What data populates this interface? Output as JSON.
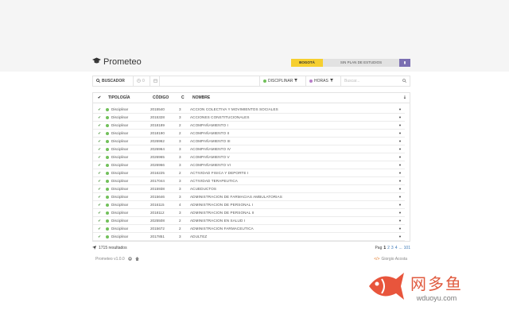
{
  "brand": {
    "name": "Prometeo",
    "icon": "graduation-cap-icon"
  },
  "tabs": [
    {
      "label": "BOGOTÁ",
      "active": true
    },
    {
      "label": "SIN PLAN DE ESTUDIOS",
      "active": false
    },
    {
      "label": "▮",
      "active": false
    }
  ],
  "toolbar": {
    "buscador_label": "BUSCADOR",
    "clock_value": "0",
    "disciplinar_label": "DISCIPLINAR",
    "horas_label": "HORAS",
    "search_placeholder": "Buscar..."
  },
  "colors": {
    "accent": "#f6cf2f",
    "disciplinar": "#71c05a",
    "horas": "#b87ec9",
    "violet": "#7b6fb2"
  },
  "table": {
    "headers": {
      "check": "✔",
      "tipologia": "TIPOLOGÍA",
      "codigo": "CÓDIGO",
      "c": "C",
      "nombre": "NOMBRE",
      "action": "⇣"
    },
    "rows": [
      {
        "tipologia": "Disciplinar",
        "codigo": "2015540",
        "c": "3",
        "nombre": "ACCION COLECTIVA Y MOVIMIENTOS SOCIALES"
      },
      {
        "tipologia": "Disciplinar",
        "codigo": "2015328",
        "c": "3",
        "nombre": "ACCIONES CONSTITUCIONALES"
      },
      {
        "tipologia": "Disciplinar",
        "codigo": "2018189",
        "c": "2",
        "nombre": "ACOMPAÑAMIENTO I"
      },
      {
        "tipologia": "Disciplinar",
        "codigo": "2018190",
        "c": "2",
        "nombre": "ACOMPAÑAMIENTO II"
      },
      {
        "tipologia": "Disciplinar",
        "codigo": "2026962",
        "c": "3",
        "nombre": "ACOMPAÑAMIENTO III"
      },
      {
        "tipologia": "Disciplinar",
        "codigo": "2026964",
        "c": "3",
        "nombre": "ACOMPAÑAMIENTO IV"
      },
      {
        "tipologia": "Disciplinar",
        "codigo": "2026965",
        "c": "3",
        "nombre": "ACOMPAÑAMIENTO V"
      },
      {
        "tipologia": "Disciplinar",
        "codigo": "2026966",
        "c": "3",
        "nombre": "ACOMPAÑAMIENTO VI"
      },
      {
        "tipologia": "Disciplinar",
        "codigo": "2016225",
        "c": "2",
        "nombre": "ACTIVIDAD FISICA Y DEPORTE I"
      },
      {
        "tipologia": "Disciplinar",
        "codigo": "2017044",
        "c": "3",
        "nombre": "ACTIVIDAD TERAPEUTICA"
      },
      {
        "tipologia": "Disciplinar",
        "codigo": "2015938",
        "c": "3",
        "nombre": "ACUEDUCTOS"
      },
      {
        "tipologia": "Disciplinar",
        "codigo": "2015646",
        "c": "3",
        "nombre": "ADMINISTRACION DE FARMACIAS AMBULATORIAS"
      },
      {
        "tipologia": "Disciplinar",
        "codigo": "2016115",
        "c": "4",
        "nombre": "ADMINISTRACION DE PERSONAL I"
      },
      {
        "tipologia": "Disciplinar",
        "codigo": "2018112",
        "c": "3",
        "nombre": "ADMINISTRACION DE PERSONAL II"
      },
      {
        "tipologia": "Disciplinar",
        "codigo": "2025508",
        "c": "2",
        "nombre": "ADMINISTRACION EN SALUD I"
      },
      {
        "tipologia": "Disciplinar",
        "codigo": "2015672",
        "c": "2",
        "nombre": "ADMINISTRACION FARMACEUTICA"
      },
      {
        "tipologia": "Disciplinar",
        "codigo": "2017851",
        "c": "3",
        "nombre": "ADULTEZ"
      }
    ]
  },
  "footer": {
    "results": "1715 resultados",
    "pag_label": "Pag",
    "pages": [
      "1",
      "2",
      "3",
      "4",
      "...",
      "101"
    ],
    "current_page": "1"
  },
  "meta": {
    "version": "Prometeo v1.0.0",
    "author": "Giorgio Acosta"
  },
  "watermark": {
    "cn": "网多鱼",
    "url": "wduoyu.com"
  }
}
